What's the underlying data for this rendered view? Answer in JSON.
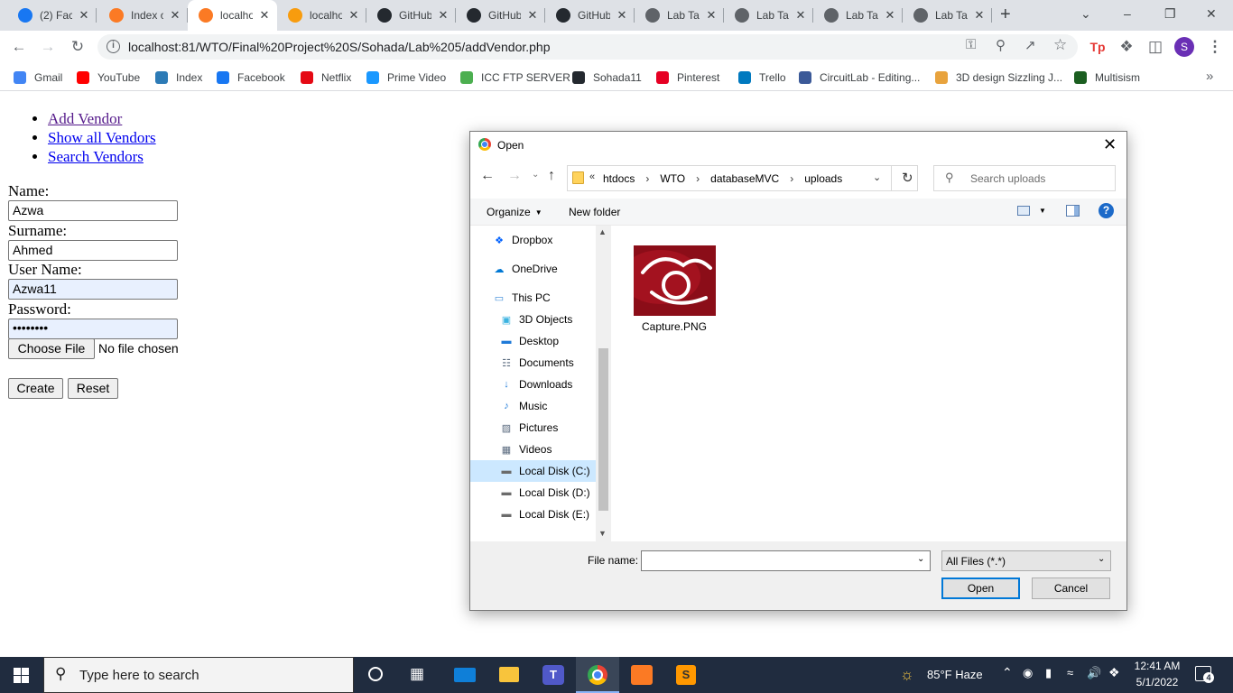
{
  "browser": {
    "tabs": [
      {
        "title": "(2) Fac",
        "icon": "facebook-icon",
        "color": "#1877f2"
      },
      {
        "title": "Index o",
        "icon": "xampp-icon",
        "color": "#fb7a24"
      },
      {
        "title": "localho",
        "icon": "xampp-icon",
        "color": "#fb7a24",
        "active": true
      },
      {
        "title": "localho",
        "icon": "phpmyadmin-icon",
        "color": "#f89c0e"
      },
      {
        "title": "GitHub",
        "icon": "github-icon",
        "color": "#24292f"
      },
      {
        "title": "GitHub",
        "icon": "github-icon",
        "color": "#24292f"
      },
      {
        "title": "GitHub",
        "icon": "github-icon",
        "color": "#24292f"
      },
      {
        "title": "Lab Ta",
        "icon": "globe-icon",
        "color": "#5f6368"
      },
      {
        "title": "Lab Ta",
        "icon": "globe-icon",
        "color": "#5f6368"
      },
      {
        "title": "Lab Ta",
        "icon": "globe-icon",
        "color": "#5f6368"
      },
      {
        "title": "Lab Ta",
        "icon": "globe-icon",
        "color": "#5f6368"
      }
    ],
    "url": "localhost:81/WTO/Final%20Project%20S/Sohada/Lab%205/addVendor.php",
    "profile_initial": "S",
    "bookmarks": [
      {
        "label": "Gmail",
        "icon": "google-icon",
        "color": "#4285f4"
      },
      {
        "label": "YouTube",
        "icon": "youtube-icon",
        "color": "#ff0000"
      },
      {
        "label": "Index",
        "icon": "index-icon",
        "color": "#2d7bb6"
      },
      {
        "label": "Facebook",
        "icon": "facebook-icon",
        "color": "#1877f2"
      },
      {
        "label": "Netflix",
        "icon": "netflix-icon",
        "color": "#e50914"
      },
      {
        "label": "Prime Video",
        "icon": "prime-video-icon",
        "color": "#1a98ff"
      },
      {
        "label": "ICC FTP SERVER",
        "icon": "ftp-icon",
        "color": "#4caf50"
      },
      {
        "label": "Sohada11",
        "icon": "github-icon",
        "color": "#24292f"
      },
      {
        "label": "Pinterest",
        "icon": "pinterest-icon",
        "color": "#e60023"
      },
      {
        "label": "Trello",
        "icon": "trello-icon",
        "color": "#0079bf"
      },
      {
        "label": "CircuitLab - Editing...",
        "icon": "circuitlab-icon",
        "color": "#3b5998"
      },
      {
        "label": "3D design Sizzling J...",
        "icon": "tinkercad-icon",
        "color": "#e8a33d"
      },
      {
        "label": "Multisism",
        "icon": "multisim-icon",
        "color": "#1b5e20"
      }
    ]
  },
  "page": {
    "nav_links": [
      "Add Vendor",
      "Show all Vendors",
      "Search Vendors"
    ],
    "form": {
      "name_label": "Name:",
      "name_value": "Azwa",
      "surname_label": "Surname:",
      "surname_value": "Ahmed",
      "username_label": "User Name:",
      "username_value": "Azwa11",
      "password_label": "Password:",
      "password_value": "••••••••",
      "choose_file_label": "Choose File",
      "no_file_text": "No file chosen",
      "create_label": "Create",
      "reset_label": "Reset"
    }
  },
  "dialog": {
    "title": "Open",
    "breadcrumb": [
      "htdocs",
      "WTO",
      "databaseMVC",
      "uploads"
    ],
    "search_placeholder": "Search uploads",
    "organize_label": "Organize",
    "new_folder_label": "New folder",
    "nav_items": [
      {
        "label": "Dropbox",
        "icon": "dropbox-icon"
      },
      {
        "label": "OneDrive",
        "icon": "onedrive-icon"
      },
      {
        "label": "This PC",
        "icon": "pc-icon"
      },
      {
        "label": "3D Objects",
        "icon": "3d-objects-icon"
      },
      {
        "label": "Desktop",
        "icon": "desktop-icon"
      },
      {
        "label": "Documents",
        "icon": "documents-icon"
      },
      {
        "label": "Downloads",
        "icon": "downloads-icon"
      },
      {
        "label": "Music",
        "icon": "music-icon"
      },
      {
        "label": "Pictures",
        "icon": "pictures-icon"
      },
      {
        "label": "Videos",
        "icon": "videos-icon"
      },
      {
        "label": "Local Disk (C:)",
        "icon": "disk-icon",
        "selected": true
      },
      {
        "label": "Local Disk (D:)",
        "icon": "disk-icon"
      },
      {
        "label": "Local Disk (E:)",
        "icon": "disk-icon"
      }
    ],
    "files": [
      {
        "name": "Capture.PNG"
      }
    ],
    "file_name_label": "File name:",
    "file_name_value": "",
    "file_type": "All Files (*.*)",
    "open_label": "Open",
    "cancel_label": "Cancel"
  },
  "taskbar": {
    "search_placeholder": "Type here to search",
    "weather": "85°F  Haze",
    "time": "12:41 AM",
    "date": "5/1/2022",
    "notifications": "4"
  }
}
